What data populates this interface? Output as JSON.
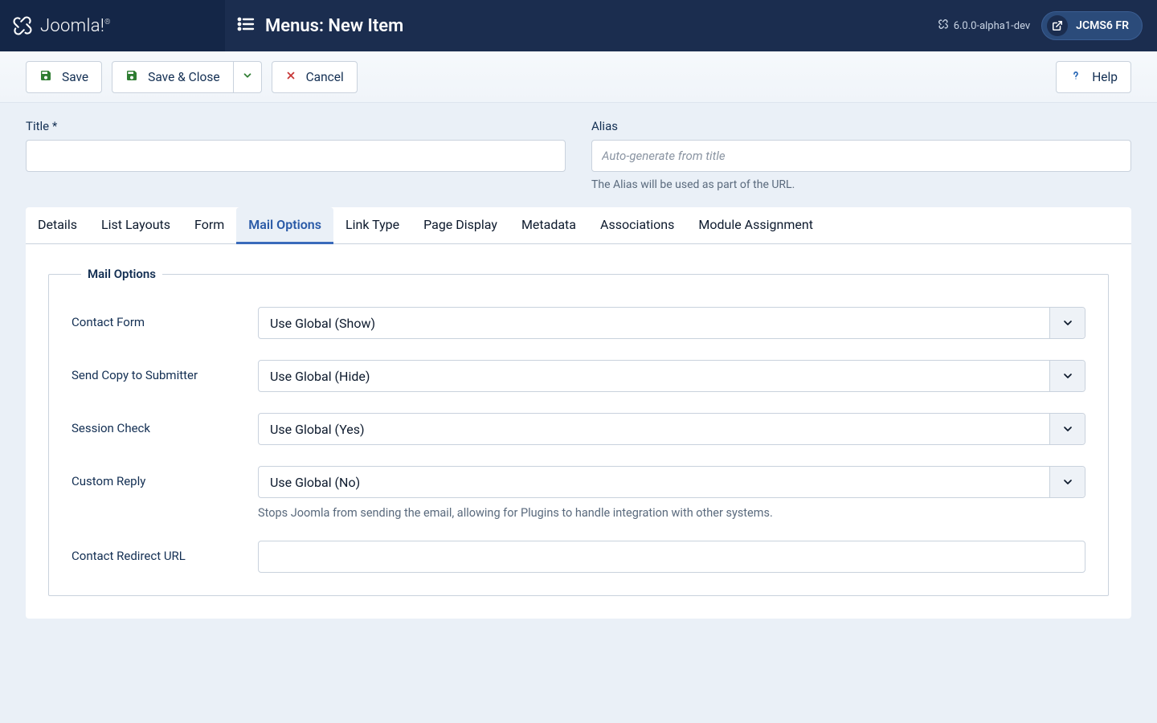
{
  "brand": {
    "name": "Joomla!"
  },
  "pageTitle": "Menus: New Item",
  "header": {
    "version": "6.0.0-alpha1-dev",
    "siteName": "JCMS6 FR"
  },
  "toolbar": {
    "save": "Save",
    "saveClose": "Save & Close",
    "cancel": "Cancel",
    "help": "Help"
  },
  "titleArea": {
    "titleLabel": "Title *",
    "aliasLabel": "Alias",
    "aliasPlaceholder": "Auto-generate from title",
    "aliasHelp": "The Alias will be used as part of the URL."
  },
  "tabs": [
    "Details",
    "List Layouts",
    "Form",
    "Mail Options",
    "Link Type",
    "Page Display",
    "Metadata",
    "Associations",
    "Module Assignment"
  ],
  "activeTabIndex": 3,
  "fieldset": {
    "legend": "Mail Options",
    "fields": {
      "contactForm": {
        "label": "Contact Form",
        "value": "Use Global (Show)"
      },
      "sendCopy": {
        "label": "Send Copy to Submitter",
        "value": "Use Global (Hide)"
      },
      "sessionCheck": {
        "label": "Session Check",
        "value": "Use Global (Yes)"
      },
      "customReply": {
        "label": "Custom Reply",
        "value": "Use Global (No)",
        "desc": "Stops Joomla from sending the email, allowing for Plugins to handle integration with other systems."
      },
      "redirectUrl": {
        "label": "Contact Redirect URL",
        "value": ""
      }
    }
  }
}
